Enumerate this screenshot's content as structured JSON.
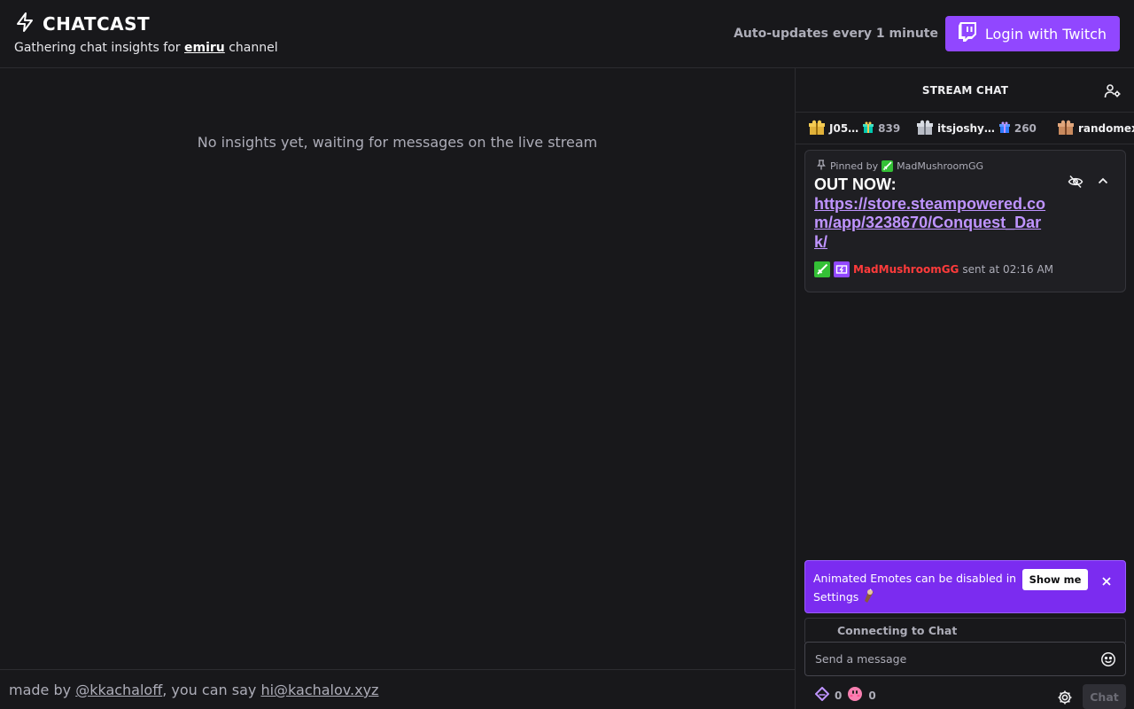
{
  "header": {
    "title": "CHATCAST",
    "subtitle_prefix": "Gathering chat insights for ",
    "channel": "emiru",
    "subtitle_suffix": " channel",
    "updates_note": "Auto-updates every 1 minute",
    "login_label": "Login with Twitch"
  },
  "main": {
    "empty_message": "No insights yet, waiting for messages on the live stream"
  },
  "footer": {
    "prefix": "made by ",
    "author": "@kkachaloff",
    "middle": ", you can say ",
    "email": "hi@kachalov.xyz"
  },
  "chat": {
    "title": "STREAM CHAT",
    "gifters": [
      {
        "name": "J05…",
        "count": "839"
      },
      {
        "name": "itsjoshy…",
        "count": "260"
      },
      {
        "name": "randomexi",
        "count": ""
      }
    ],
    "pinned": {
      "pinned_by_label": "Pinned by",
      "pinned_by_user": "MadMushroomGG",
      "text": "OUT NOW:",
      "link": "https://store.steampowered.com/app/3238670/Conquest_Dark/",
      "sender": "MadMushroomGG",
      "sent_at": "sent at 02:16 AM"
    },
    "notice": {
      "text": "Animated Emotes can be disabled in Settings",
      "button": "Show me"
    },
    "connecting": "Connecting to Chat",
    "input_placeholder": "Send a message",
    "points_1": "0",
    "points_2": "0",
    "send_label": "Chat"
  },
  "colors": {
    "accent": "#9147ff",
    "background": "#18181b",
    "link": "#bf94ff",
    "sender": "#ff3b3b"
  }
}
